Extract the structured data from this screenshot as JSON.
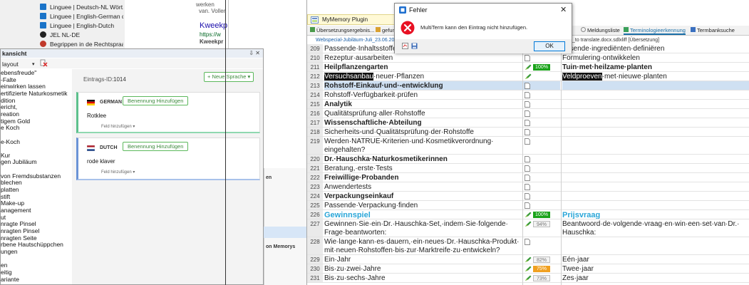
{
  "browser_menu": {
    "items": [
      {
        "label": "Linguee | Deutsch-NL Wört...",
        "icon": "linguee-icon"
      },
      {
        "label": "Linguee | English-German d...",
        "icon": "linguee-icon"
      },
      {
        "label": "Linguee | English-Dutch",
        "icon": "linguee-icon"
      },
      {
        "label": "JEL NL-DE",
        "icon": "globe-icon"
      },
      {
        "label": "Begrippen in de Rechtspraa...",
        "icon": "rechtspraak-icon"
      }
    ]
  },
  "search_snippet": {
    "line1": "werken",
    "line2": "van. Voller",
    "link": "Kweekp",
    "url": "https://w",
    "bold": "Kweekpr"
  },
  "entry_panel": {
    "title": "kansicht",
    "pin": "⇩ ✕",
    "layout_label": "layout",
    "entry_id_label": "Eintrags-ID:",
    "entry_id_value": "1014",
    "new_language_button": "+ Neue Sprache ▾",
    "terms": [
      "ebensfreude\"",
      "-Falte",
      "einwirken lassen",
      "ertifizierte Naturkosmetik",
      "dition",
      "ericht,",
      "reation",
      "tigem Gold",
      "e Koch",
      "",
      "e-Koch",
      "",
      "Kur",
      "gen Jubiläum",
      "",
      "von Fremdsubstanzen",
      "blechen",
      "platten",
      "stift",
      "Make-up",
      "anagement",
      "ut",
      "nragte Pinsel",
      "nragten Pinsel",
      "nragten Seite",
      "rbene Hautschüppchen",
      "ungen",
      "",
      "en",
      "eitig",
      "ariante"
    ],
    "german": {
      "lang": "GERMAN",
      "button": "Benennung Hinzufügen",
      "term": "Rotklee",
      "feld": "Feld hinzufügen ▾"
    },
    "dutch": {
      "lang": "DUTCH",
      "button": "Benennung Hinzufügen",
      "term": "rode klaver",
      "feld": "Feld hinzufügen ▾"
    }
  },
  "mid_panel": {
    "label1": "en",
    "label2": "on Memorys"
  },
  "editor": {
    "plugin_label": "MyMemory Plugin",
    "tabs": [
      {
        "label": "Übersetzungsergebnis...",
        "active": false
      },
      {
        "label": "gefun",
        "active": false
      },
      {
        "label": "Meldungsliste",
        "active": false
      },
      {
        "label": "Terminologieerkennung",
        "active": true
      },
      {
        "label": "Termbanksuche",
        "active": false
      }
    ],
    "doc_tab": "Webspecial-Jubiläum-Juli_23.06.201",
    "doc_tab_right": "_to translate.docx.sdlxliff [Übersetzung]",
    "rows": [
      {
        "num": "209",
        "src": "Passende·Inhaltsstoffe",
        "tgt": "assende·ingrediënten·definiëren",
        "status": "doc",
        "pct": "",
        "style": ""
      },
      {
        "num": "210",
        "src": "Rezeptur·ausarbeiten",
        "tgt": "Formulering·ontwikkelen",
        "status": "doc",
        "pct": "",
        "style": ""
      },
      {
        "num": "211",
        "src": "Heilpflanzengarten",
        "tgt": "Tuin·met·heilzame·planten",
        "status": "pen",
        "pct": "100%",
        "pctc": "green",
        "style": "bold"
      },
      {
        "num": "212",
        "src": "Versuchsanbau·neuer·Pflanzen",
        "src_hl": "Versuchsanbau",
        "src_rest": "·neuer·Pflanzen",
        "tgt_hl": "Veldproeven",
        "tgt_rest": "·met·nieuwe·planten",
        "status": "pen",
        "pct": "",
        "style": ""
      },
      {
        "num": "213",
        "src": "Rohstoff-Einkauf·und·-entwicklung",
        "tgt": "",
        "status": "doc",
        "pct": "",
        "style": "bold",
        "selected": true
      },
      {
        "num": "214",
        "src": "Rohstoff-Verfügbarkeit·prüfen",
        "tgt": "",
        "status": "doc",
        "pct": "",
        "style": ""
      },
      {
        "num": "215",
        "src": "Analytik",
        "tgt": "",
        "status": "doc",
        "pct": "",
        "style": "bold"
      },
      {
        "num": "216",
        "src": "Qualitätsprüfung·aller·Rohstoffe",
        "tgt": "",
        "status": "doc",
        "pct": "",
        "style": ""
      },
      {
        "num": "217",
        "src": "Wissenschaftliche·Abteilung",
        "tgt": "",
        "status": "doc",
        "pct": "",
        "style": "bold"
      },
      {
        "num": "218",
        "src": "Sicherheits-und·Qualitätsprüfung·der·Rohstoffe",
        "tgt": "",
        "status": "doc",
        "pct": "",
        "style": ""
      },
      {
        "num": "219",
        "src": "Werden·NATRUE-Kriterien·und·Kosmetikverordnung· eingehalten?",
        "tgt": "",
        "status": "doc",
        "pct": "",
        "style": "",
        "tall": true
      },
      {
        "num": "220",
        "src": "Dr.·Hauschka·Naturkosmetikerinnen",
        "tgt": "",
        "status": "doc",
        "pct": "",
        "style": "bold"
      },
      {
        "num": "221",
        "src": "Beratung,·erste·Tests",
        "tgt": "",
        "status": "doc",
        "pct": "",
        "style": ""
      },
      {
        "num": "222",
        "src": "Freiwillige·Probanden",
        "tgt": "",
        "status": "doc",
        "pct": "",
        "style": "bold"
      },
      {
        "num": "223",
        "src": "Anwendertests",
        "tgt": "",
        "status": "doc",
        "pct": "",
        "style": ""
      },
      {
        "num": "224",
        "src": "Verpackungseinkauf",
        "tgt": "",
        "status": "doc",
        "pct": "",
        "style": "bold"
      },
      {
        "num": "225",
        "src": "Passende·Verpackung·finden",
        "tgt": "",
        "status": "doc",
        "pct": "",
        "style": ""
      },
      {
        "num": "226",
        "src": "Gewinnspiel",
        "tgt": "Prijsvraag",
        "status": "pen",
        "pct": "100%",
        "pctc": "green",
        "style": "heading"
      },
      {
        "num": "227",
        "src": "Gewinnen·Sie·ein·Dr.·Hauschka-Set,·indem·Sie·folgende· Frage·beantworten:",
        "tgt": "Beantwoord·de·volgende·vraag·en·win·een·set·van·Dr.· Hauschka:",
        "status": "pen",
        "pct": "94%",
        "pctc": "grey",
        "style": "",
        "tall": true
      },
      {
        "num": "228",
        "src": "Wie·lange·kann·es·dauern,·ein·neues·Dr.·Hauschka-Produkt· mit·neuen·Rohstoffen·bis·zur·Marktreife·zu·entwickeln?",
        "tgt": "",
        "status": "doc",
        "pct": "",
        "style": "",
        "tall": true
      },
      {
        "num": "229",
        "src": "Ein·Jahr",
        "tgt": "Eén·jaar",
        "status": "pen",
        "pct": "82%",
        "pctc": "grey",
        "style": ""
      },
      {
        "num": "230",
        "src": "Bis·zu·zwei·Jahre",
        "tgt": "Twee·jaar",
        "status": "pen",
        "pct": "75%",
        "pctc": "orange",
        "style": ""
      },
      {
        "num": "231",
        "src": "Bis·zu·sechs·Jahre",
        "tgt": "Zes·jaar",
        "status": "pen",
        "pct": "73%",
        "pctc": "grey",
        "style": ""
      }
    ]
  },
  "dialog": {
    "title": "Fehler",
    "close": "✕",
    "message": "MultiTerm kann den Eintrag nicht hinzufügen.",
    "ok": "OK"
  }
}
